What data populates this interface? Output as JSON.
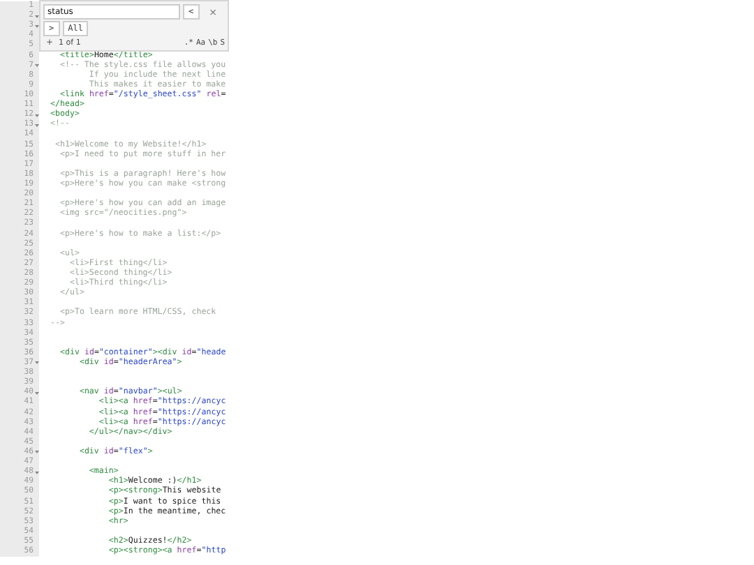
{
  "search_panel": {
    "query": "status",
    "prev_button": "<",
    "close_button": "×",
    "replace_toggle": ">",
    "replace_scope": "All",
    "add_button": "+",
    "match_count": "1 of 1",
    "options": [
      ".*",
      "Aa",
      "\\b",
      "S"
    ]
  },
  "lines": [
    {
      "number": "1",
      "fold": false
    },
    {
      "number": "2",
      "fold": true
    },
    {
      "number": "3",
      "fold": true
    },
    {
      "number": "4",
      "fold": false
    },
    {
      "number": "5",
      "fold": false
    },
    {
      "number": "6",
      "fold": false,
      "kind": "code",
      "text": "  <title>Home</title>"
    },
    {
      "number": "7",
      "fold": true,
      "kind": "comment",
      "text": "  <!-- The style.css file allows you"
    },
    {
      "number": "8",
      "fold": false,
      "kind": "comment",
      "text": "        If you include the next line"
    },
    {
      "number": "9",
      "fold": false,
      "kind": "comment",
      "text": "        This makes it easier to make"
    },
    {
      "number": "10",
      "fold": false,
      "kind": "code",
      "text": "  <link href=\"/style_sheet.css\" rel="
    },
    {
      "number": "11",
      "fold": false,
      "kind": "code",
      "text": "</head>"
    },
    {
      "number": "12",
      "fold": true,
      "kind": "code",
      "text": "<body>"
    },
    {
      "number": "13",
      "fold": true,
      "kind": "comment",
      "text": "<!--"
    },
    {
      "number": "14",
      "fold": false
    },
    {
      "number": "15",
      "fold": false,
      "kind": "comment",
      "text": " <h1>Welcome to my Website!</h1>"
    },
    {
      "number": "16",
      "fold": false,
      "kind": "comment",
      "text": "  <p>I need to put more stuff in her"
    },
    {
      "number": "17",
      "fold": false
    },
    {
      "number": "18",
      "fold": false,
      "kind": "comment",
      "text": "  <p>This is a paragraph! Here's how"
    },
    {
      "number": "19",
      "fold": false,
      "kind": "comment",
      "text": "  <p>Here's how you can make <strong"
    },
    {
      "number": "20",
      "fold": false
    },
    {
      "number": "21",
      "fold": false,
      "kind": "comment",
      "text": "  <p>Here's how you can add an image"
    },
    {
      "number": "22",
      "fold": false,
      "kind": "comment",
      "text": "  <img src=\"/neocities.png\">"
    },
    {
      "number": "23",
      "fold": false
    },
    {
      "number": "24",
      "fold": false,
      "kind": "comment",
      "text": "  <p>Here's how to make a list:</p>"
    },
    {
      "number": "25",
      "fold": false
    },
    {
      "number": "26",
      "fold": false,
      "kind": "comment",
      "text": "  <ul>"
    },
    {
      "number": "27",
      "fold": false,
      "kind": "comment",
      "text": "    <li>First thing</li>"
    },
    {
      "number": "28",
      "fold": false,
      "kind": "comment",
      "text": "    <li>Second thing</li>"
    },
    {
      "number": "29",
      "fold": false,
      "kind": "comment",
      "text": "    <li>Third thing</li>"
    },
    {
      "number": "30",
      "fold": false,
      "kind": "comment",
      "text": "  </ul>"
    },
    {
      "number": "31",
      "fold": false
    },
    {
      "number": "32",
      "fold": false,
      "kind": "comment",
      "text": "  <p>To learn more HTML/CSS, check"
    },
    {
      "number": "33",
      "fold": false,
      "kind": "comment",
      "text": "-->"
    },
    {
      "number": "34",
      "fold": false
    },
    {
      "number": "35",
      "fold": false
    },
    {
      "number": "36",
      "fold": false,
      "kind": "code",
      "text": "  <div id=\"container\"><div id=\"heade"
    },
    {
      "number": "37",
      "fold": true,
      "kind": "code",
      "text": "      <div id=\"headerArea\">"
    },
    {
      "number": "38",
      "fold": false
    },
    {
      "number": "39",
      "fold": false
    },
    {
      "number": "40",
      "fold": true,
      "kind": "code",
      "text": "      <nav id=\"navbar\"><ul>"
    },
    {
      "number": "41",
      "fold": false,
      "kind": "code",
      "text": "          <li><a href=\"https://ancyc"
    },
    {
      "number": "42",
      "fold": false,
      "kind": "code",
      "text": "          <li><a href=\"https://ancyc"
    },
    {
      "number": "43",
      "fold": false,
      "kind": "code",
      "text": "          <li><a href=\"https://ancyc"
    },
    {
      "number": "44",
      "fold": false,
      "kind": "code",
      "text": "        </ul></nav></div>"
    },
    {
      "number": "45",
      "fold": false
    },
    {
      "number": "46",
      "fold": true,
      "kind": "code",
      "text": "      <div id=\"flex\">"
    },
    {
      "number": "47",
      "fold": false
    },
    {
      "number": "48",
      "fold": true,
      "kind": "code",
      "text": "        <main>"
    },
    {
      "number": "49",
      "fold": false,
      "kind": "code",
      "text": "            <h1>Welcome :)</h1>"
    },
    {
      "number": "50",
      "fold": false,
      "kind": "code",
      "text": "            <p><strong>This website"
    },
    {
      "number": "51",
      "fold": false,
      "kind": "code",
      "text": "            <p>I want to spice this"
    },
    {
      "number": "52",
      "fold": false,
      "kind": "code",
      "text": "            <p>In the meantime, chec"
    },
    {
      "number": "53",
      "fold": false,
      "kind": "code",
      "text": "            <hr>"
    },
    {
      "number": "54",
      "fold": false
    },
    {
      "number": "55",
      "fold": false,
      "kind": "code",
      "text": "            <h2>Quizzes!</h2>"
    },
    {
      "number": "56",
      "fold": false,
      "kind": "code",
      "text": "            <p><strong><a href=\"http"
    }
  ]
}
